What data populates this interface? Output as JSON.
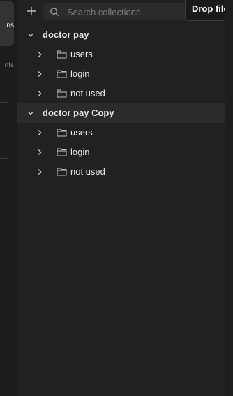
{
  "sidebar": {
    "items": [
      {
        "label": "ns",
        "active": true
      },
      {
        "label": "nts",
        "active": false
      }
    ]
  },
  "toolbar": {
    "search_placeholder": "Search collections",
    "tooltip": "Drop files a"
  },
  "collections": [
    {
      "name": "doctor pay",
      "folders": [
        "users",
        "login",
        "not used"
      ]
    },
    {
      "name": "doctor pay Copy",
      "folders": [
        "users",
        "login",
        "not used"
      ]
    }
  ],
  "icons": {
    "add": "plus-icon",
    "search": "search-icon",
    "expanded": "chevron-down-icon",
    "collapsed": "chevron-right-icon",
    "folder": "folder-icon"
  }
}
